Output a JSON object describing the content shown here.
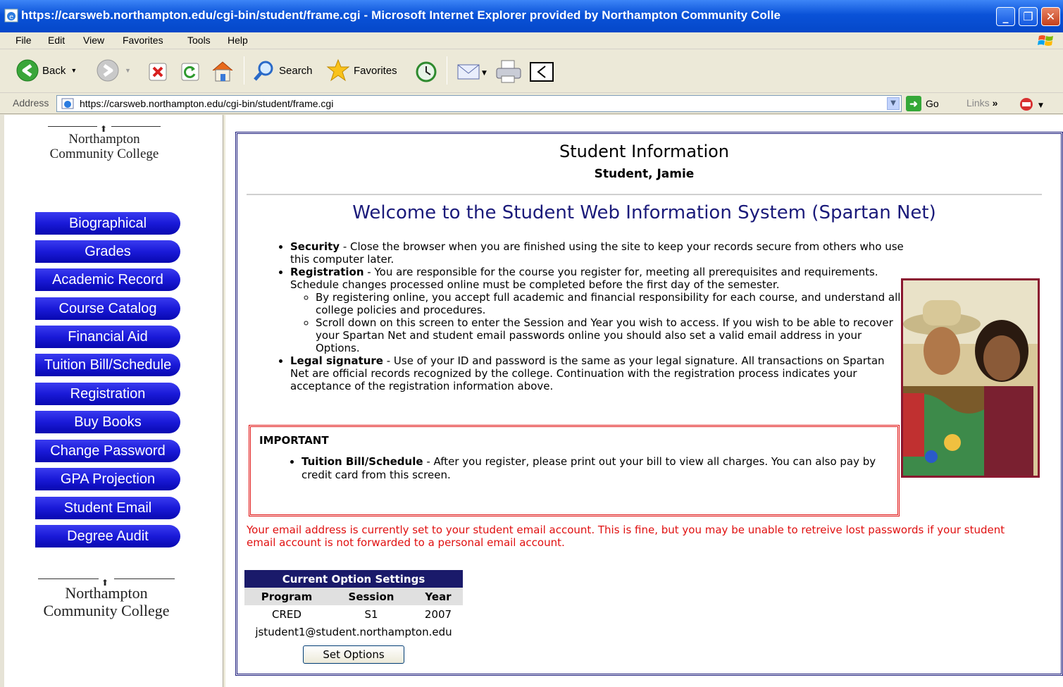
{
  "window": {
    "title": "https://carsweb.northampton.edu/cgi-bin/student/frame.cgi - Microsoft Internet Explorer provided by Northampton Community Colle",
    "minimize": "_",
    "restore": "❐",
    "close": "✕"
  },
  "menu": [
    "File",
    "Edit",
    "View",
    "Favorites",
    "Tools",
    "Help"
  ],
  "toolbar": {
    "back": "Back",
    "search": "Search",
    "favorites": "Favorites"
  },
  "address": {
    "label": "Address",
    "url": "https://carsweb.northampton.edu/cgi-bin/student/frame.cgi",
    "go": "Go",
    "links": "Links"
  },
  "sidebar": {
    "logo_line1": "Northampton",
    "logo_line2": "Community College",
    "items": [
      "Biographical",
      "Grades",
      "Academic Record",
      "Course Catalog",
      "Financial Aid",
      "Tuition Bill/Schedule",
      "Registration",
      "Buy Books",
      "Change Password",
      "GPA Projection",
      "Student Email",
      "Degree Audit"
    ]
  },
  "main": {
    "heading": "Student Information",
    "student_name": "Student, Jamie",
    "welcome": "Welcome to the Student Web Information System (Spartan Net)",
    "security_title": "Security",
    "security_text": " - Close the browser when you are finished using the site to keep your records secure from others who use this computer later.",
    "registration_title": "Registration",
    "registration_text": " - You are responsible for the course you register for, meeting all prerequisites and requirements. Schedule changes processed online must be completed before the first day of the semester.",
    "sub1": "By registering online, you accept full academic and financial responsibility for each course, and understand all college policies and procedures.",
    "sub2": "Scroll down on this screen to enter the Session and Year you wish to access. If you wish to be able to recover your Spartan Net and student email passwords online you should also set a valid email address in your Options.",
    "legal_title": "Legal signature",
    "legal_text": " - Use of your ID and password is the same as your legal signature. All transactions on Spartan Net are official records recognized by the college. Continuation with the registration process indicates your acceptance of the registration information above.",
    "important_head": "IMPORTANT",
    "tuition_title": "Tuition Bill/Schedule",
    "tuition_text": " - After you register, please print out your bill to view all charges. You can also pay by credit card from this screen.",
    "warning": "Your email address is currently set to your student email account. This is fine, but you may be unable to retreive lost passwords if your student email account is not forwarded to a personal email account."
  },
  "options": {
    "caption": "Current Option Settings",
    "headers": [
      "Program",
      "Session",
      "Year"
    ],
    "row": [
      "CRED",
      "S1",
      "2007"
    ],
    "email": "jstudent1@student.northampton.edu",
    "button": "Set Options"
  }
}
